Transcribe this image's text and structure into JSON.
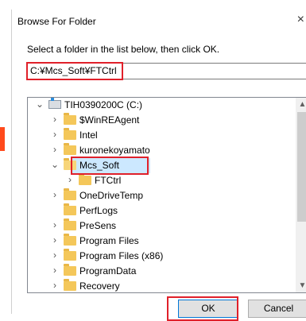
{
  "dialog": {
    "title": "Browse For Folder",
    "instruction": "Select a folder in the list below, then click OK.",
    "path_value": "C:¥Mcs_Soft¥FTCtrl",
    "ok_label": "OK",
    "cancel_label": "Cancel",
    "close_glyph": "×"
  },
  "tree": {
    "items": [
      {
        "label": "TIH0390200C (C:)",
        "icon": "drive-icon",
        "expander": "expanded"
      },
      {
        "label": "$WinREAgent",
        "icon": "folder-icon",
        "expander": "collapsed"
      },
      {
        "label": "Intel",
        "icon": "folder-icon",
        "expander": "collapsed"
      },
      {
        "label": "kuronekoyamato",
        "icon": "folder-icon",
        "expander": "collapsed"
      },
      {
        "label": "Mcs_Soft",
        "icon": "folder-open-icon",
        "expander": "expanded",
        "selected": true
      },
      {
        "label": "FTCtrl",
        "icon": "folder-icon",
        "expander": "collapsed"
      },
      {
        "label": "OneDriveTemp",
        "icon": "folder-icon",
        "expander": "collapsed"
      },
      {
        "label": "PerfLogs",
        "icon": "folder-icon",
        "expander": "none"
      },
      {
        "label": "PreSens",
        "icon": "folder-icon",
        "expander": "collapsed"
      },
      {
        "label": "Program Files",
        "icon": "folder-icon",
        "expander": "collapsed"
      },
      {
        "label": "Program Files (x86)",
        "icon": "folder-icon",
        "expander": "collapsed"
      },
      {
        "label": "ProgramData",
        "icon": "folder-icon",
        "expander": "collapsed"
      },
      {
        "label": "Recovery",
        "icon": "folder-icon",
        "expander": "collapsed"
      }
    ]
  },
  "colors": {
    "highlight_box": "#e0202a",
    "selection": "#cce8ff",
    "folder": "#f4c75a",
    "arrow": "#ff4a1c"
  }
}
